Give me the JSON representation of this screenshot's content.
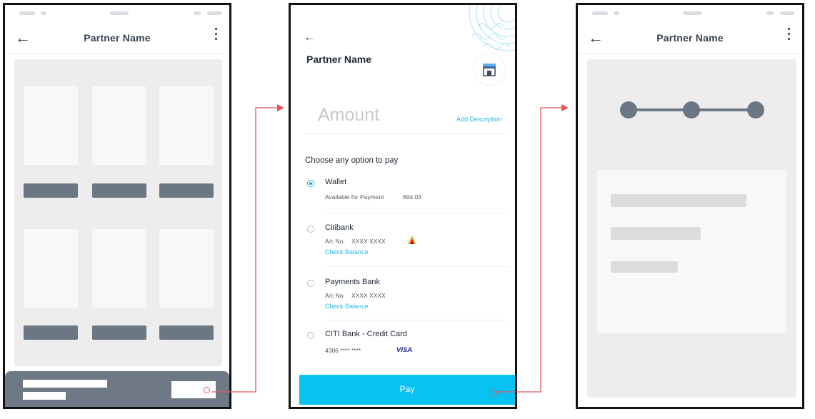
{
  "screen1": {
    "title": "Partner Name"
  },
  "screen2": {
    "title": "Partner Name",
    "amount_placeholder": "Amount",
    "add_description": "Add Description",
    "choose_label": "Choose any option to pay",
    "options": [
      {
        "name": "Wallet",
        "sub_label": "Available for Payment",
        "sub_value": "694.03",
        "selected": true
      },
      {
        "name": "Citibank",
        "sub_label": "A/c No.",
        "sub_value": "XXXX XXXX",
        "link": "Check Balance"
      },
      {
        "name": "Payments Bank",
        "sub_label": "A/c No.",
        "sub_value": "XXXX XXXX",
        "link": "Check Balance"
      },
      {
        "name": "CITI Bank - Credit Card",
        "sub_label": "4386 **** ****",
        "brand": "VISA"
      }
    ],
    "pay_label": "Pay"
  },
  "screen3": {
    "title": "Partner Name"
  },
  "colors": {
    "accent": "#08c3f1",
    "link": "#2bb8e6",
    "arrow": "#e4575d",
    "placeholder_bar": "#6b7783"
  },
  "icons": [
    "back-arrow-icon",
    "more-vertical-icon",
    "store-icon",
    "bank-logo-icon",
    "visa-logo"
  ]
}
